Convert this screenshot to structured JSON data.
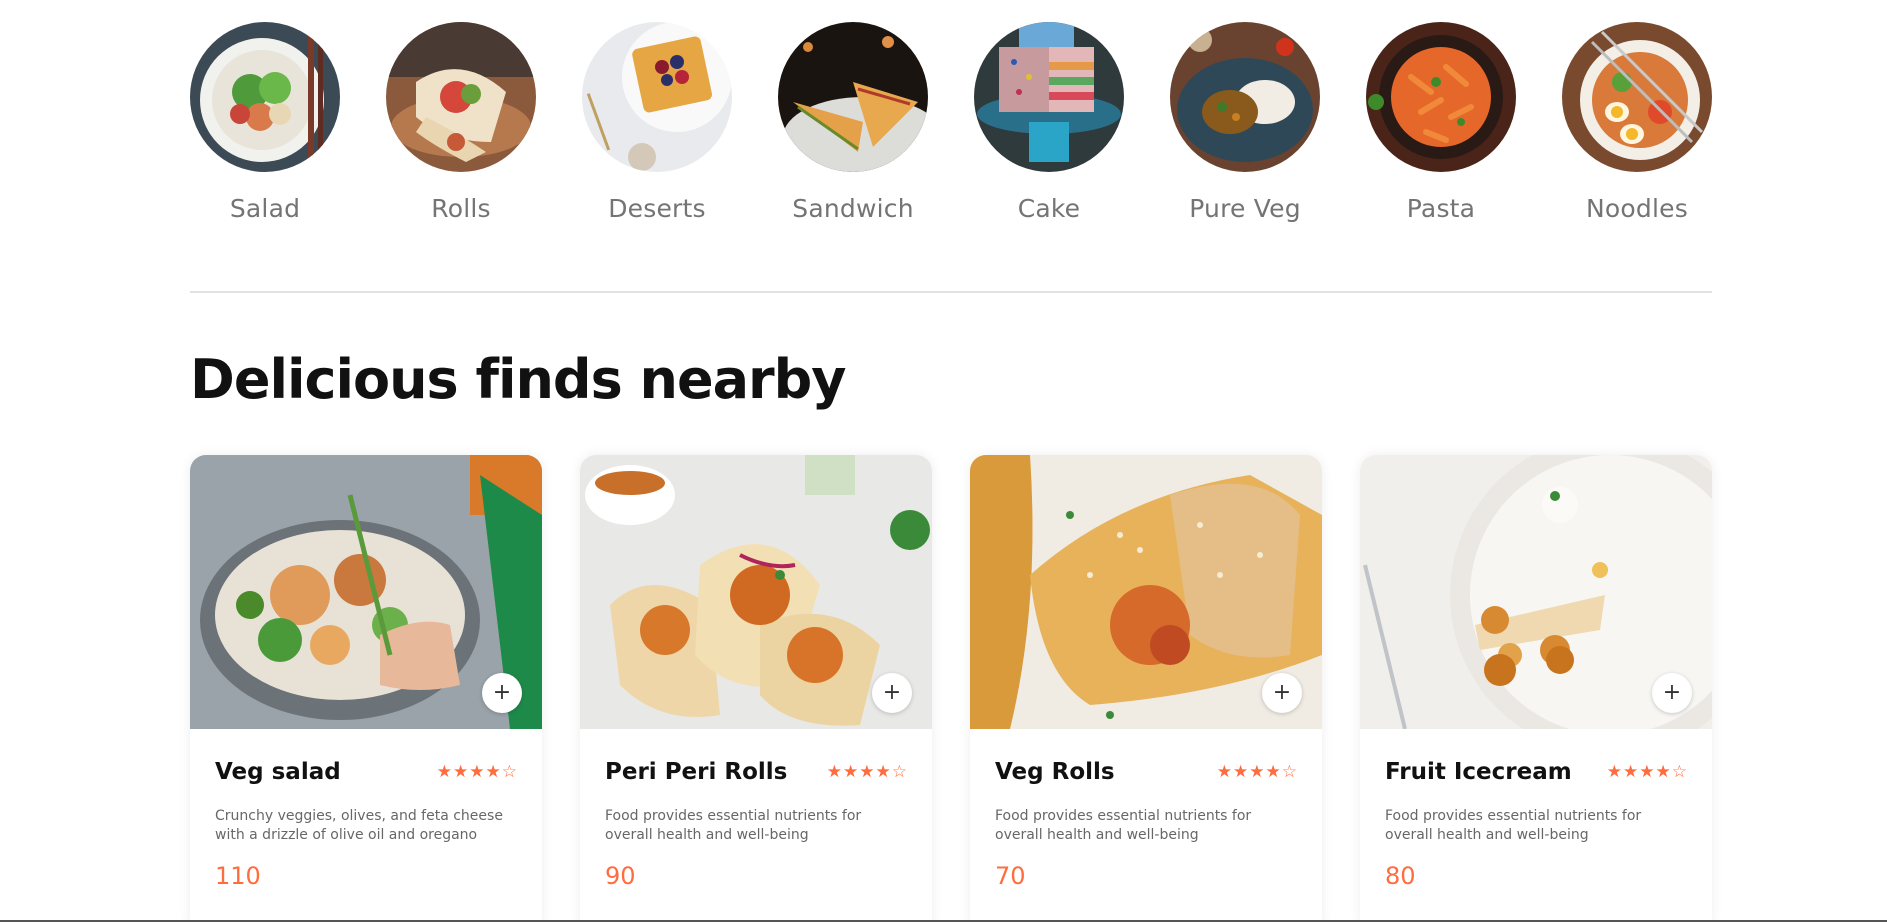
{
  "categories": [
    {
      "label": "Salad",
      "image": "salad-bowl-image"
    },
    {
      "label": "Rolls",
      "image": "wrap-rolls-image"
    },
    {
      "label": "Deserts",
      "image": "waffle-dessert-image"
    },
    {
      "label": "Sandwich",
      "image": "grilled-sandwich-image"
    },
    {
      "label": "Cake",
      "image": "rainbow-cake-image"
    },
    {
      "label": "Pure Veg",
      "image": "curry-rice-plate-image"
    },
    {
      "label": "Pasta",
      "image": "penne-pasta-image"
    },
    {
      "label": "Noodles",
      "image": "noodle-bowl-image"
    }
  ],
  "section": {
    "title": "Delicious finds nearby"
  },
  "cards": [
    {
      "name": "Veg salad",
      "desc": "Crunchy veggies, olives, and feta cheese with a drizzle of olive oil and oregano",
      "price": "110",
      "rating": 4,
      "add_label": "+"
    },
    {
      "name": "Peri Peri Rolls",
      "desc": "Food provides essential nutrients for overall health and well-being",
      "price": "90",
      "rating": 4,
      "add_label": "+"
    },
    {
      "name": "Veg Rolls",
      "desc": "Food provides essential nutrients for overall health and well-being",
      "price": "70",
      "rating": 4,
      "add_label": "+"
    },
    {
      "name": "Fruit Icecream",
      "desc": "Food provides essential nutrients for overall health and well-being",
      "price": "80",
      "rating": 4,
      "add_label": "+"
    }
  ],
  "colors": {
    "accent": "#ff6c3e",
    "label": "#747474",
    "divider": "#e2e2e2"
  }
}
